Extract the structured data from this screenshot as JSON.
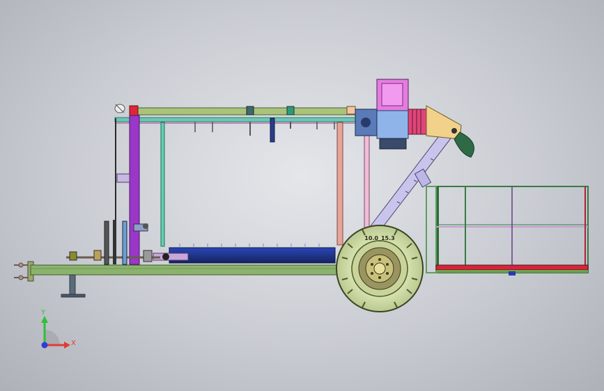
{
  "view": {
    "background_color": "#c9ccd2"
  },
  "tire": {
    "size_text": "10.0_15.3"
  },
  "triad": {
    "y_label": "Y",
    "x_label": "X",
    "y_color": "#2fbf3a",
    "x_color": "#e23a3a",
    "z_color": "#2a3fd6"
  }
}
